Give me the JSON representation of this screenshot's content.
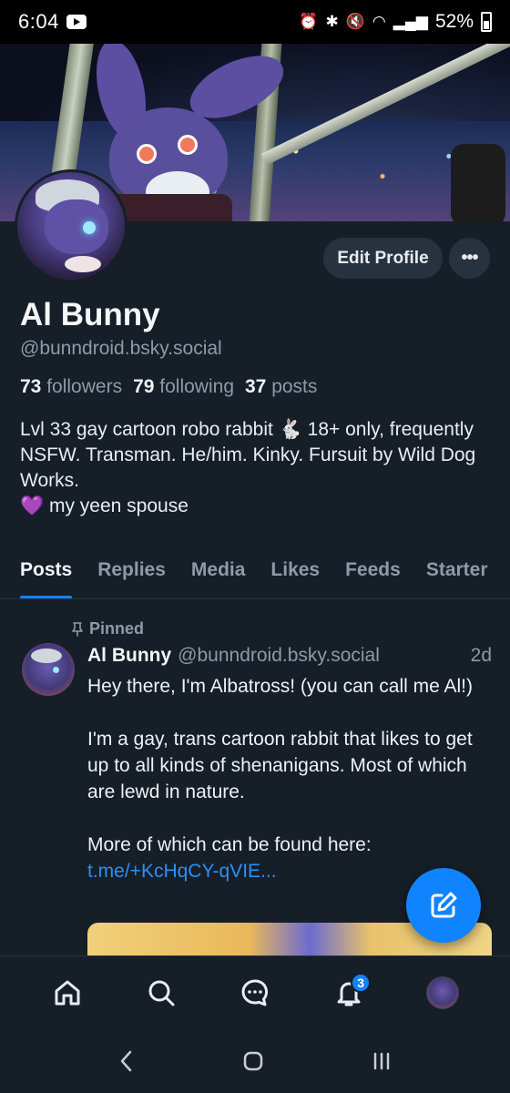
{
  "status_bar": {
    "time": "6:04",
    "battery": "52%",
    "icons": [
      "youtube-icon",
      "alarm-icon",
      "bluetooth-icon",
      "mute-icon",
      "wifi-icon",
      "signal-icon",
      "battery-icon"
    ]
  },
  "profile": {
    "display_name": "Al Bunny",
    "handle": "@bunndroid.bsky.social",
    "followers_count": "73",
    "followers_label": "followers",
    "following_count": "79",
    "following_label": "following",
    "posts_count": "37",
    "posts_label": "posts",
    "bio_line1": "Lvl 33 gay cartoon robo rabbit 🐇 18+ only, frequently NSFW. Transman. He/him. Kinky. Fursuit by Wild Dog Works.",
    "bio_line2": "💜 my yeen spouse",
    "edit_label": "Edit Profile",
    "more_label": "•••"
  },
  "tabs": [
    {
      "label": "Posts",
      "active": true
    },
    {
      "label": "Replies",
      "active": false
    },
    {
      "label": "Media",
      "active": false
    },
    {
      "label": "Likes",
      "active": false
    },
    {
      "label": "Feeds",
      "active": false
    },
    {
      "label": "Starter",
      "active": false
    }
  ],
  "post": {
    "pinned_label": "Pinned",
    "author_name": "Al Bunny",
    "author_handle": "@bunndroid.bsky.social",
    "time": "2d",
    "para1": "Hey there, I'm Albatross! (you can call me Al!)",
    "para2": "I'm a gay, trans cartoon rabbit that likes to get up to all kinds of shenanigans. Most of which are lewd in nature.",
    "para3": "More of which can be found here:",
    "link": "t.me/+KcHqCY-qVIE..."
  },
  "bottom_nav": {
    "items": [
      "home-icon",
      "search-icon",
      "chat-icon",
      "notifications-icon",
      "profile-avatar"
    ],
    "notification_badge": "3"
  },
  "colors": {
    "background": "#161e27",
    "accent": "#1083fe",
    "muted_text": "#8e9aa8",
    "button_bg": "#28323e"
  }
}
